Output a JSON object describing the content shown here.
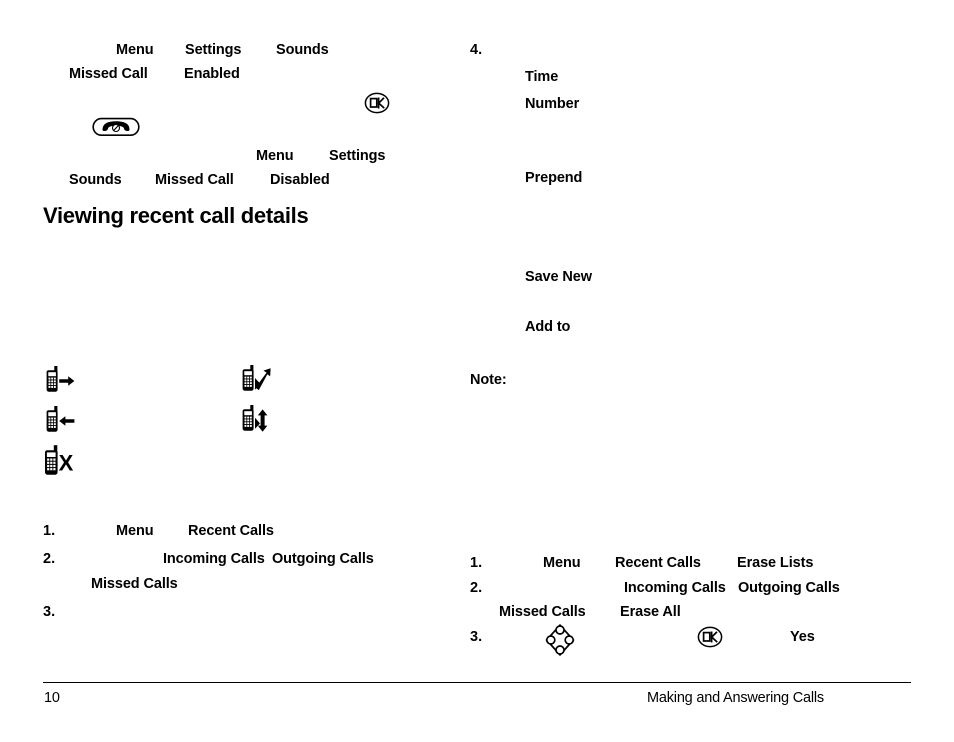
{
  "document": {
    "type": "phone-user-manual-page",
    "page_number": "10",
    "footer_section": "Making and Answering Calls"
  },
  "left_column": {
    "para1": {
      "frag1": "Menu",
      "frag2": "Settings",
      "frag3": "Sounds",
      "frag4": "Missed Call",
      "frag5": "Enabled"
    },
    "para2": {
      "frag1": "Menu",
      "frag2": "Settings",
      "frag3": "Sounds",
      "frag4": "Missed Call",
      "frag5": "Disabled"
    },
    "heading": "Viewing recent call details",
    "icons": [
      {
        "name": "phone-outgoing-call-icon",
        "label": ""
      },
      {
        "name": "phone-incoming-call-icon",
        "label": ""
      },
      {
        "name": "phone-missed-call-icon",
        "label": ""
      },
      {
        "name": "phone-call-forwarded-icon",
        "label": ""
      },
      {
        "name": "phone-call-in-out-icon",
        "label": ""
      }
    ],
    "steps": [
      {
        "num": "1.",
        "frag1": "Menu",
        "frag2": "Recent Calls",
        "frag3": "",
        "frag4": ""
      },
      {
        "num": "2.",
        "frag1": "Incoming Calls",
        "frag2": "Outgoing Calls",
        "frag3": "Missed Calls",
        "frag4": ""
      },
      {
        "num": "3.",
        "frag1": "",
        "frag2": "",
        "frag3": "",
        "frag4": ""
      }
    ]
  },
  "right_column": {
    "step4_num": "4.",
    "labels": {
      "time": "Time",
      "number": "Number",
      "prepend": "Prepend",
      "save_new": "Save New",
      "add_to": "Add to"
    },
    "note_label": "Note:",
    "steps": [
      {
        "num": "1.",
        "frag1": "Menu",
        "frag2": "Recent Calls",
        "frag3": "Erase Lists"
      },
      {
        "num": "2.",
        "frag1": "Incoming Calls",
        "frag2": "Outgoing Calls",
        "frag3": "Missed Calls",
        "frag4": "Erase All"
      },
      {
        "num": "3.",
        "frag1": "Yes"
      }
    ]
  },
  "keys": {
    "ok_key": "OK",
    "end_call_key": "end-call",
    "navigation_key": "navigation"
  }
}
